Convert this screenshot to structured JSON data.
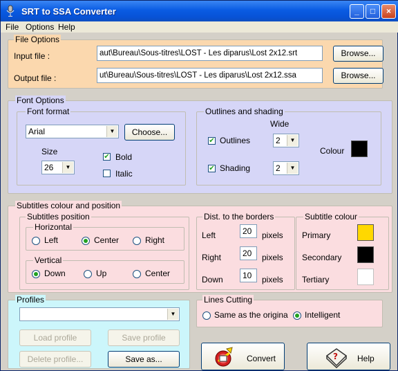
{
  "window": {
    "title": "SRT to SSA Converter",
    "controls": [
      "_",
      "□",
      "×"
    ]
  },
  "menu": [
    "File",
    "Options",
    "Help"
  ],
  "file_options": {
    "title": "File Options",
    "input_label": "Input file :",
    "input_value": "aut\\Bureau\\Sous-titres\\LOST - Les diparus\\Lost 2x12.srt",
    "output_label": "Output file :",
    "output_value": "ut\\Bureau\\Sous-titres\\LOST - Les diparus\\Lost 2x12.ssa",
    "browse_label": "Browse..."
  },
  "font_options": {
    "title": "Font Options",
    "font_format": {
      "title": "Font format",
      "font": "Arial",
      "choose_label": "Choose...",
      "size_label": "Size",
      "size_value": "26",
      "bold_label": "Bold",
      "bold_checked": true,
      "italic_label": "Italic",
      "italic_checked": false
    },
    "outlines": {
      "title": "Outlines and shading",
      "wide_label": "Wide",
      "outlines_label": "Outlines",
      "outlines_checked": true,
      "outlines_value": "2",
      "shading_label": "Shading",
      "shading_checked": true,
      "shading_value": "2",
      "colour_label": "Colour",
      "colour": "#000000"
    }
  },
  "subtitles": {
    "title": "Subtitles colour and position",
    "position": {
      "title": "Subtitles position",
      "horizontal": {
        "title": "Horizontal",
        "options": [
          "Left",
          "Center",
          "Right"
        ],
        "selected": "Center"
      },
      "vertical": {
        "title": "Vertical",
        "options": [
          "Down",
          "Up",
          "Center"
        ],
        "selected": "Down"
      }
    },
    "borders": {
      "title": "Dist. to the borders",
      "unit": "pixels",
      "rows": [
        {
          "label": "Left",
          "value": "20"
        },
        {
          "label": "Right",
          "value": "20"
        },
        {
          "label": "Down",
          "value": "10"
        }
      ]
    },
    "colour": {
      "title": "Subtitle colour",
      "rows": [
        {
          "label": "Primary",
          "color": "#ffd800"
        },
        {
          "label": "Secondary",
          "color": "#000000"
        },
        {
          "label": "Tertiary",
          "color": "#ffffff"
        }
      ]
    }
  },
  "profiles": {
    "title": "Profiles",
    "selected": "",
    "load_label": "Load profile",
    "save_label": "Save profile",
    "delete_label": "Delete profile...",
    "saveas_label": "Save as..."
  },
  "lines_cutting": {
    "title": "Lines Cutting",
    "options": [
      "Same as the origina",
      "Intelligent"
    ],
    "selected": "Intelligent"
  },
  "actions": {
    "convert_label": "Convert",
    "help_label": "Help"
  }
}
